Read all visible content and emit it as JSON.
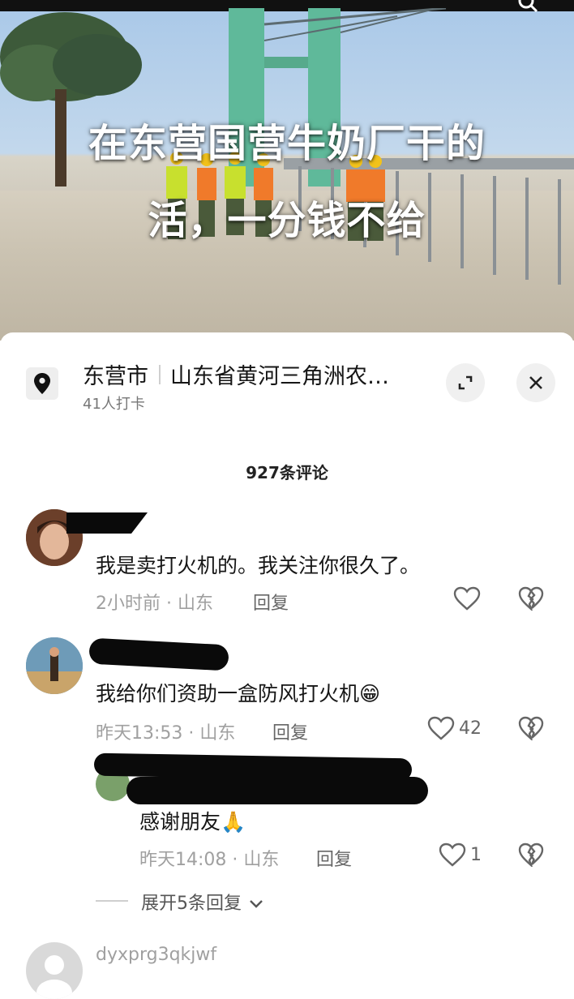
{
  "video": {
    "overlay_line1": "在东营国营牛奶厂干的",
    "overlay_line2": "活，一分钱不给"
  },
  "location": {
    "city": "东营市",
    "place": "山东省黄河三角洲农…",
    "checkins": "41人打卡"
  },
  "comments_header": "927条评论",
  "comments": [
    {
      "text": "我是卖打火机的。我关注你很久了。",
      "time": "2小时前",
      "region": "山东",
      "reply_label": "回复",
      "likes": ""
    },
    {
      "text": "我给你们资助一盒防风打火机😁",
      "time": "昨天13:53",
      "region": "山东",
      "reply_label": "回复",
      "likes": "42"
    },
    {
      "text": "感谢朋友🙏",
      "time": "昨天14:08",
      "region": "山东",
      "reply_label": "回复",
      "likes": "1"
    }
  ],
  "expand_replies": "展开5条回复",
  "next_comment_user": "dyxprg3qkjwf",
  "icons": {
    "location": "map-pin-icon",
    "expand": "expand-icon",
    "close": "close-icon",
    "like": "heart-icon",
    "dislike": "broken-heart-icon",
    "chevron": "chevron-down-icon"
  }
}
